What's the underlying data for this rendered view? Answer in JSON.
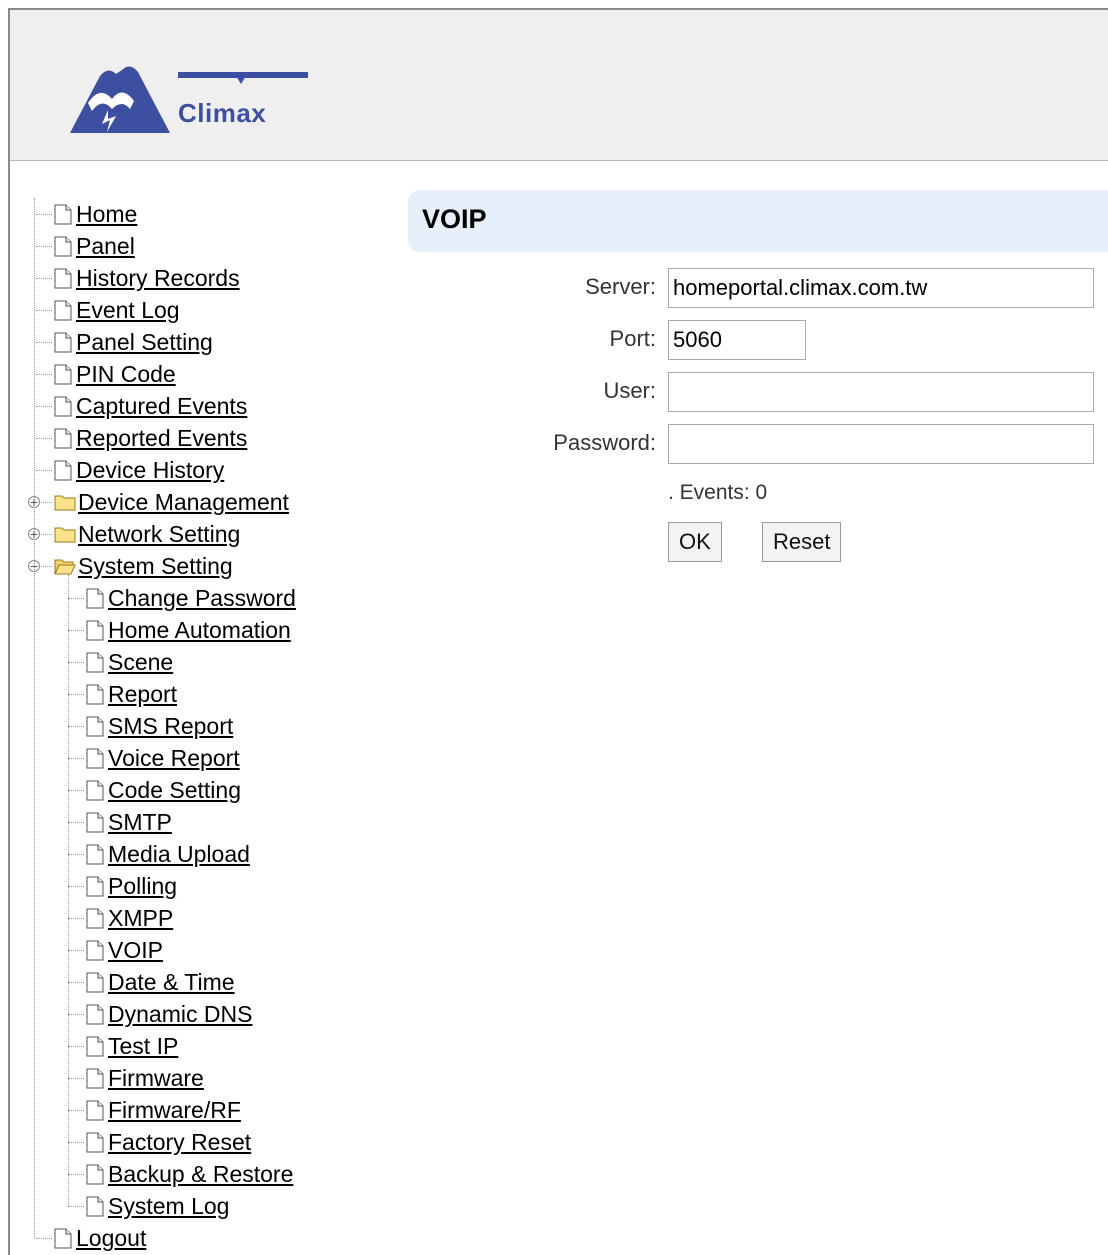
{
  "brand": {
    "name": "Climax"
  },
  "page": {
    "title": "VOIP"
  },
  "nav": {
    "top_items": [
      "Home",
      "Panel",
      "History Records",
      "Event Log",
      "Panel Setting",
      "PIN Code",
      "Captured Events",
      "Reported Events",
      "Device History"
    ],
    "folders": [
      {
        "label": "Device Management",
        "expanded": false
      },
      {
        "label": "Network Setting",
        "expanded": false
      },
      {
        "label": "System Setting",
        "expanded": true
      }
    ],
    "system_items": [
      "Change Password",
      "Home Automation",
      "Scene",
      "Report",
      "SMS Report",
      "Voice Report",
      "Code Setting",
      "SMTP",
      "Media Upload",
      "Polling",
      "XMPP",
      "VOIP",
      "Date & Time",
      "Dynamic DNS",
      "Test IP",
      "Firmware",
      "Firmware/RF",
      "Factory Reset",
      "Backup & Restore",
      "System Log"
    ],
    "logout": "Logout"
  },
  "form": {
    "server_label": "Server:",
    "server_value": "homeportal.climax.com.tw",
    "port_label": "Port:",
    "port_value": "5060",
    "user_label": "User:",
    "user_value": "",
    "password_label": "Password:",
    "password_value": "",
    "events_text": ". Events: 0",
    "ok_label": "OK",
    "reset_label": "Reset"
  },
  "colors": {
    "brand": "#3c4fa0",
    "title_bar": "#e7effa",
    "header_bg": "#efefef"
  }
}
